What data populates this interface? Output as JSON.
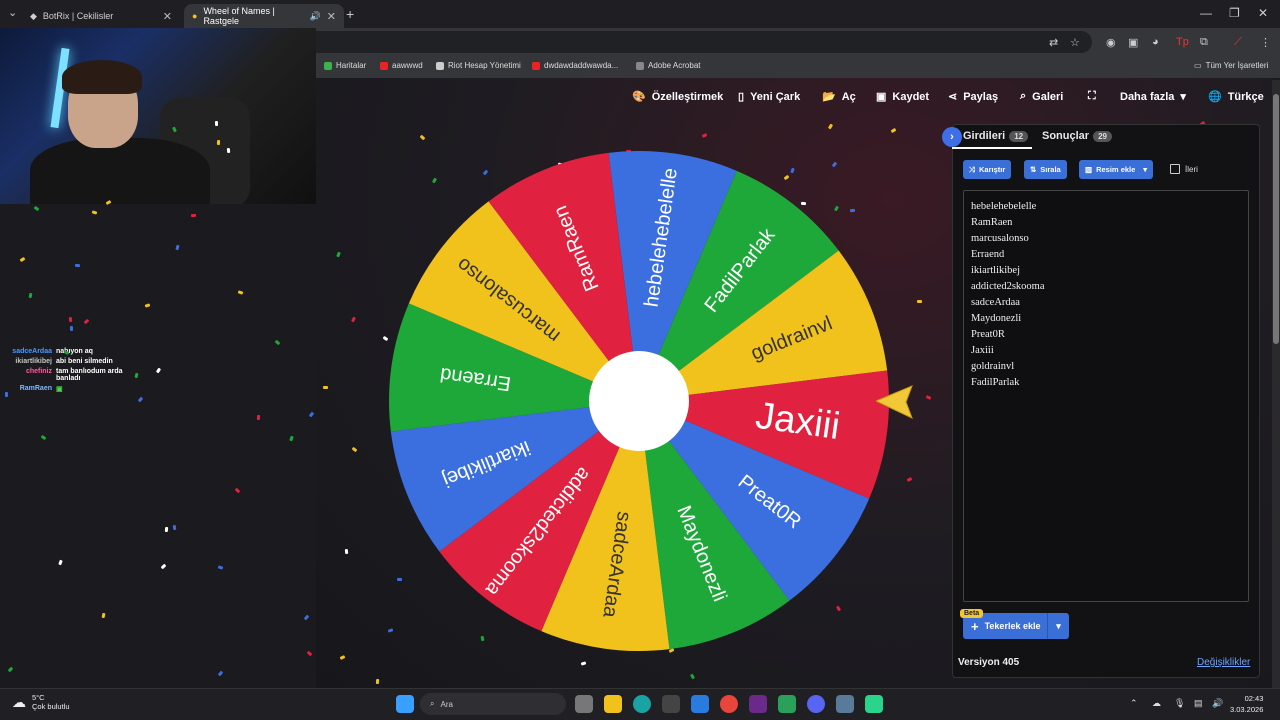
{
  "browser": {
    "tabs": [
      {
        "title": "BotRix | Cekilisler"
      },
      {
        "title": "Wheel of Names | Rastgele"
      }
    ],
    "bookmarks": [
      "Haritalar",
      "aawwwd",
      "Riot Hesap Yönetimi",
      "dwdawdaddwawda...",
      "Adobe Acrobat"
    ],
    "all_bookmarks": "Tüm Yer İşaretleri"
  },
  "chat": [
    {
      "user": "sadceArdaa",
      "message": "nabıyon aq",
      "color": "#4a9aff"
    },
    {
      "user": "ikiartlikibej",
      "message": "abi beni silmedin",
      "color": "#c5c5c5"
    },
    {
      "user": "chefiniz",
      "message": "tam banlıodum arda banladı",
      "color": "#ff5aa0"
    },
    {
      "user": "RamRaen",
      "message": "",
      "color": "#7cb7ff"
    }
  ],
  "nav": {
    "customize": "Özelleştirmek",
    "new_wheel": "Yeni Çark",
    "open": "Aç",
    "save": "Kaydet",
    "share": "Paylaş",
    "gallery": "Galeri",
    "more": "Daha fazla",
    "language": "Türkçe"
  },
  "wheel": {
    "colors": [
      "#3b6fe0",
      "#1fa83a",
      "#f2c21c",
      "#e0213f"
    ],
    "segments": [
      "hebelehebelelle",
      "FadilParlak",
      "goldrainvl",
      "Jaxiii",
      "Preat0R",
      "Maydonezli",
      "sadceArdaa",
      "addicted2skooma",
      "ikiartlikibej",
      "Erraend",
      "marcusalonso",
      "RamRaen"
    ],
    "winner": "Jaxiii"
  },
  "panel": {
    "tab_entries": "Girdileri",
    "entries_count": "12",
    "tab_results": "Sonuçlar",
    "results_count": "29",
    "shuffle": "Karıştır",
    "sort": "Sırala",
    "add_image": "Resim ekle",
    "advanced": "İleri",
    "entries": [
      "hebelehebelelle",
      "RamRaen",
      "marcusalonso",
      "Erraend",
      "ikiartlikibej",
      "addicted2skooma",
      "sadceArdaa",
      "Maydonezli",
      "Preat0R",
      "Jaxiii",
      "goldrainvl",
      "FadilParlak"
    ],
    "beta": "Beta",
    "add_wheel": "Tekerlek ekle",
    "version": "Versiyon 405",
    "changes": "Değişiklikler"
  },
  "taskbar": {
    "temperature": "5°C",
    "weather": "Çok bulutlu",
    "search": "Ara",
    "time": "02:43",
    "date": "3.03.2026"
  }
}
